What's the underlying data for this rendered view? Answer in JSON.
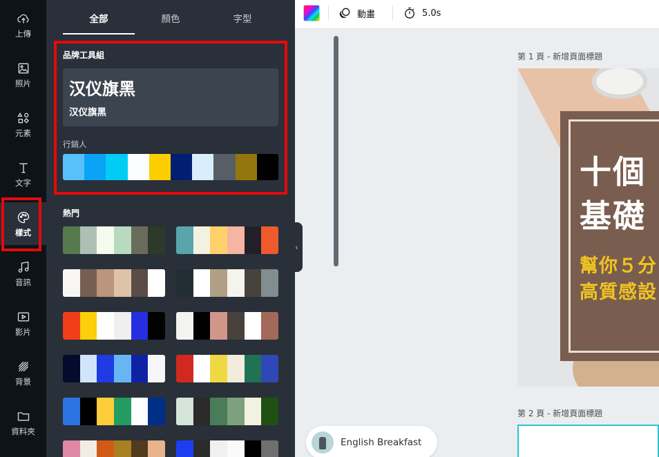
{
  "rail": {
    "items": [
      {
        "label": "上傳",
        "icon": "cloud-upload-icon"
      },
      {
        "label": "照片",
        "icon": "image-icon"
      },
      {
        "label": "元素",
        "icon": "shapes-icon"
      },
      {
        "label": "文字",
        "icon": "text-icon"
      },
      {
        "label": "樣式",
        "icon": "palette-icon"
      },
      {
        "label": "音訊",
        "icon": "music-note-icon"
      },
      {
        "label": "影片",
        "icon": "video-icon"
      },
      {
        "label": "背景",
        "icon": "background-pattern-icon"
      },
      {
        "label": "資料夾",
        "icon": "folder-icon"
      }
    ],
    "active": "樣式"
  },
  "panel": {
    "tabs": [
      "全部",
      "顏色",
      "字型"
    ],
    "active_tab": "全部",
    "brand_kit": {
      "title": "品牌工具組",
      "font_heading": "汉仪旗黑",
      "font_subheading": "汉仪旗黑",
      "palette_label": "行銷人",
      "palette": [
        "#58c1fa",
        "#0aa3f5",
        "#00ccf5",
        "#fbfdff",
        "#fcce00",
        "#001e72",
        "#d8eefc",
        "#575e66",
        "#94760e",
        "#000000"
      ]
    },
    "hot_title": "熱門",
    "hot_palettes": [
      [
        "#56794e",
        "#aec0b3",
        "#f6fbed",
        "#b8dbbf",
        "#6b6b5b",
        "#2d3a29"
      ],
      [
        "#5aa5ab",
        "#f5f1e0",
        "#fed16b",
        "#f5b5a1",
        "#221f2b",
        "#ef5a2d"
      ],
      [
        "#f7f6f3",
        "#775e52",
        "#bc957c",
        "#dec3a8",
        "#5c4c47",
        "#ffffff"
      ],
      [
        "#222e33",
        "#ffffff",
        "#b09f84",
        "#f5f3ee",
        "#48423d",
        "#818d8e"
      ],
      [
        "#f23e18",
        "#fbcf0a",
        "#ffffff",
        "#efefef",
        "#252ee0",
        "#020202"
      ],
      [
        "#f3f3f0",
        "#010101",
        "#d0968a",
        "#48403a",
        "#ffffff",
        "#a2685a"
      ],
      [
        "#040c2d",
        "#d0e4fb",
        "#1f3be3",
        "#66b6f6",
        "#0f22a6",
        "#f5f6fa"
      ],
      [
        "#d02a20",
        "#ffffff",
        "#efd843",
        "#f1ecdc",
        "#1f7253",
        "#3048b5"
      ],
      [
        "#2c73e3",
        "#000000",
        "#fdcd3a",
        "#229c61",
        "#ffffff",
        "#002f87"
      ],
      [
        "#d4e4d6",
        "#2b2b2b",
        "#4a7c59",
        "#7fa07c",
        "#f3f1e2",
        "#205014"
      ],
      [
        "#e089a6",
        "#f1ede4",
        "#d15a16",
        "#a87f22",
        "#513a1d",
        "#e9b48c"
      ],
      [
        "#1d3ef0",
        "#2b2b2b",
        "#f0f0f0",
        "#fafafa",
        "#000000",
        "#6f6f6f"
      ]
    ]
  },
  "toolbar": {
    "animate_label": "動畫",
    "duration_label": "5.0s"
  },
  "canvas": {
    "page1_label": "第 1 頁 - 新增頁面標題",
    "page2_label": "第 2 頁 - 新增頁面標題",
    "heading_line1": "十個",
    "heading_line2": "基礎",
    "sub_line1": "幫你５分",
    "sub_line2": "高質感設"
  },
  "music": {
    "title": "English Breakfast"
  },
  "colors": {
    "highlight": "#e5090b",
    "rail_bg": "#0e1318",
    "panel_bg": "#293039",
    "card_brown": "#795d4e",
    "card_yellow": "#f1c321",
    "page2_border": "#2cc3d2"
  }
}
